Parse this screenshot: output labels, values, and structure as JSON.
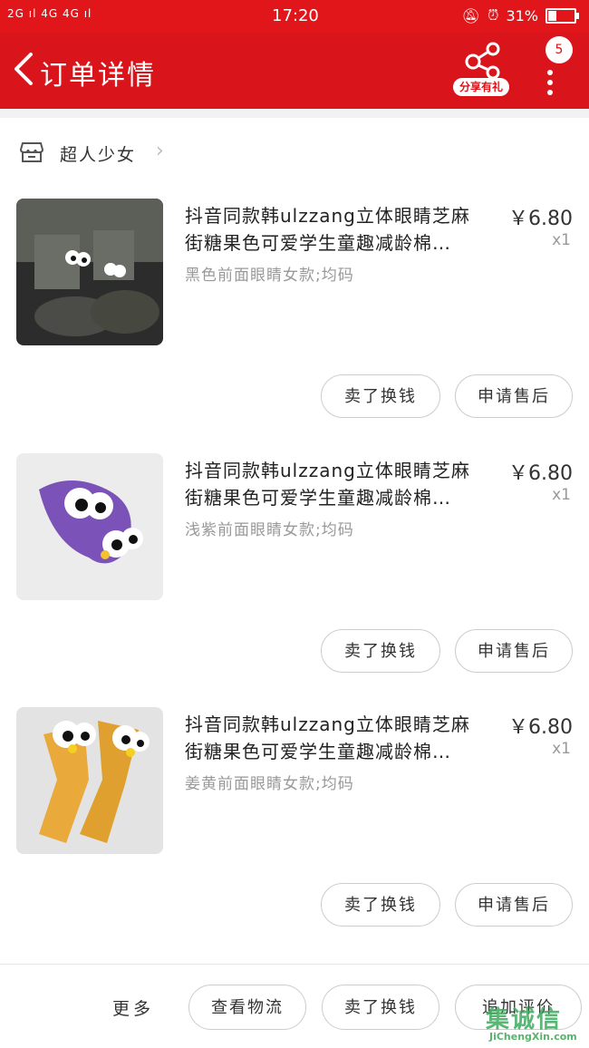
{
  "status_bar": {
    "signal_left": "2G ıl 4G 4G ıl",
    "time": "17:20",
    "battery_text": "31%"
  },
  "header": {
    "title": "订单详情",
    "share_label": "分享有礼",
    "message_badge": "5",
    "accent_color": "#d9141a"
  },
  "shop": {
    "name": "超人少女"
  },
  "items": [
    {
      "name_line1": "抖音同款韩ulzzang立体眼睛芝麻",
      "name_line2": "街糖果色可爱学生童趣减龄棉…",
      "spec": "黑色前面眼睛女款;均码",
      "price": "￥6.80",
      "quantity": "x1",
      "btn_exchange": "卖了换钱",
      "btn_aftersale": "申请售后",
      "image_color": "#3a3a3a"
    },
    {
      "name_line1": "抖音同款韩ulzzang立体眼睛芝麻",
      "name_line2": "街糖果色可爱学生童趣减龄棉…",
      "spec": "浅紫前面眼睛女款;均码",
      "price": "￥6.80",
      "quantity": "x1",
      "btn_exchange": "卖了换钱",
      "btn_aftersale": "申请售后",
      "image_color": "#7a52b8"
    },
    {
      "name_line1": "抖音同款韩ulzzang立体眼睛芝麻",
      "name_line2": "街糖果色可爱学生童趣减龄棉…",
      "spec": "姜黄前面眼睛女款;均码",
      "price": "￥6.80",
      "quantity": "x1",
      "btn_exchange": "卖了换钱",
      "btn_aftersale": "申请售后",
      "image_color": "#e9a93b"
    }
  ],
  "bottom_bar": {
    "more": "更多",
    "logistics": "查看物流",
    "exchange": "卖了换钱",
    "review": "追加评价"
  },
  "watermark": {
    "brand": "集诚信",
    "url": "JiChengXin.com"
  }
}
